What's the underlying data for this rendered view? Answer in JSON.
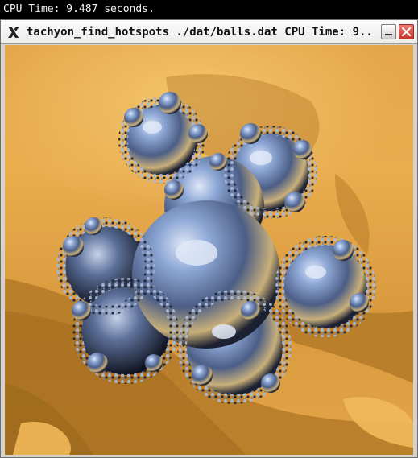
{
  "console": {
    "text": "CPU Time: 9.487 seconds."
  },
  "window": {
    "title": "tachyon_find_hotspots ./dat/balls.dat CPU Time: 9....",
    "app_icon": "x-logo-icon",
    "buttons": {
      "minimize": "minimize-icon",
      "close": "close-icon"
    }
  },
  "render": {
    "scene": "balls.dat",
    "colors": {
      "floor": "#e3a548",
      "shadow": "#b57b27",
      "sphere": "#7f97c0",
      "sphere_dark": "#1f2638"
    }
  }
}
